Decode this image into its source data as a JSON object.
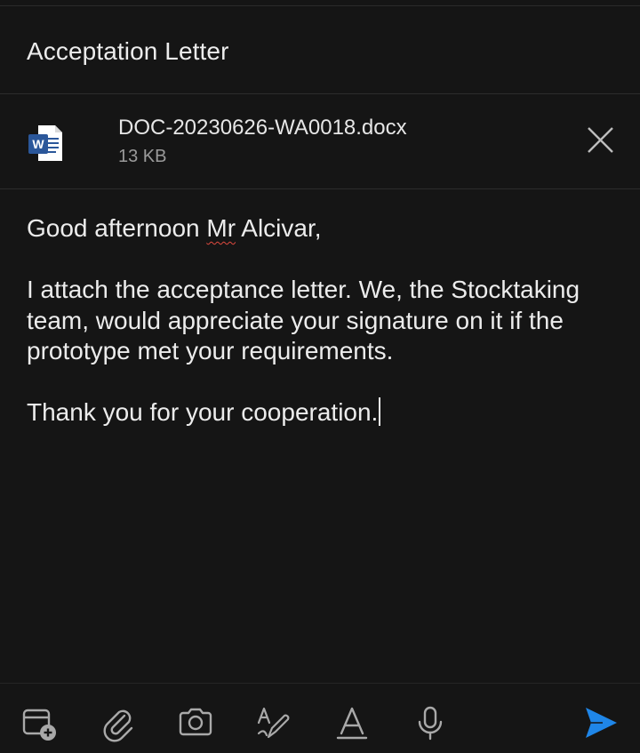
{
  "compose": {
    "subject": "Acceptation Letter",
    "attachment": {
      "file_name": "DOC-20230626-WA0018.docx",
      "file_size": "13 KB",
      "icon": "word-doc-icon",
      "remove_icon": "close-icon"
    },
    "body": {
      "greeting_prefix": "Good afternoon ",
      "greeting_flagged_word": "Mr",
      "greeting_suffix": " Alcivar,",
      "paragraph_1_line_1": "I attach the acceptance letter. We, the Stocktaking",
      "paragraph_1_line_2": "team, would appreciate your signature on it if the",
      "paragraph_1_line_3": "prototype met your requirements.",
      "closing": "Thank you for your cooperation."
    }
  },
  "toolbar": {
    "icons": [
      "calendar-add-icon",
      "paperclip-icon",
      "camera-icon",
      "handwriting-icon",
      "text-format-icon",
      "microphone-icon",
      "send-icon"
    ]
  },
  "colors": {
    "background": "#151515",
    "text": "#ececec",
    "secondary_text": "#9a9a9a",
    "accent_blue": "#1f86e8",
    "word_blue": "#2b579a",
    "spellcheck_red": "#e04a3f"
  }
}
